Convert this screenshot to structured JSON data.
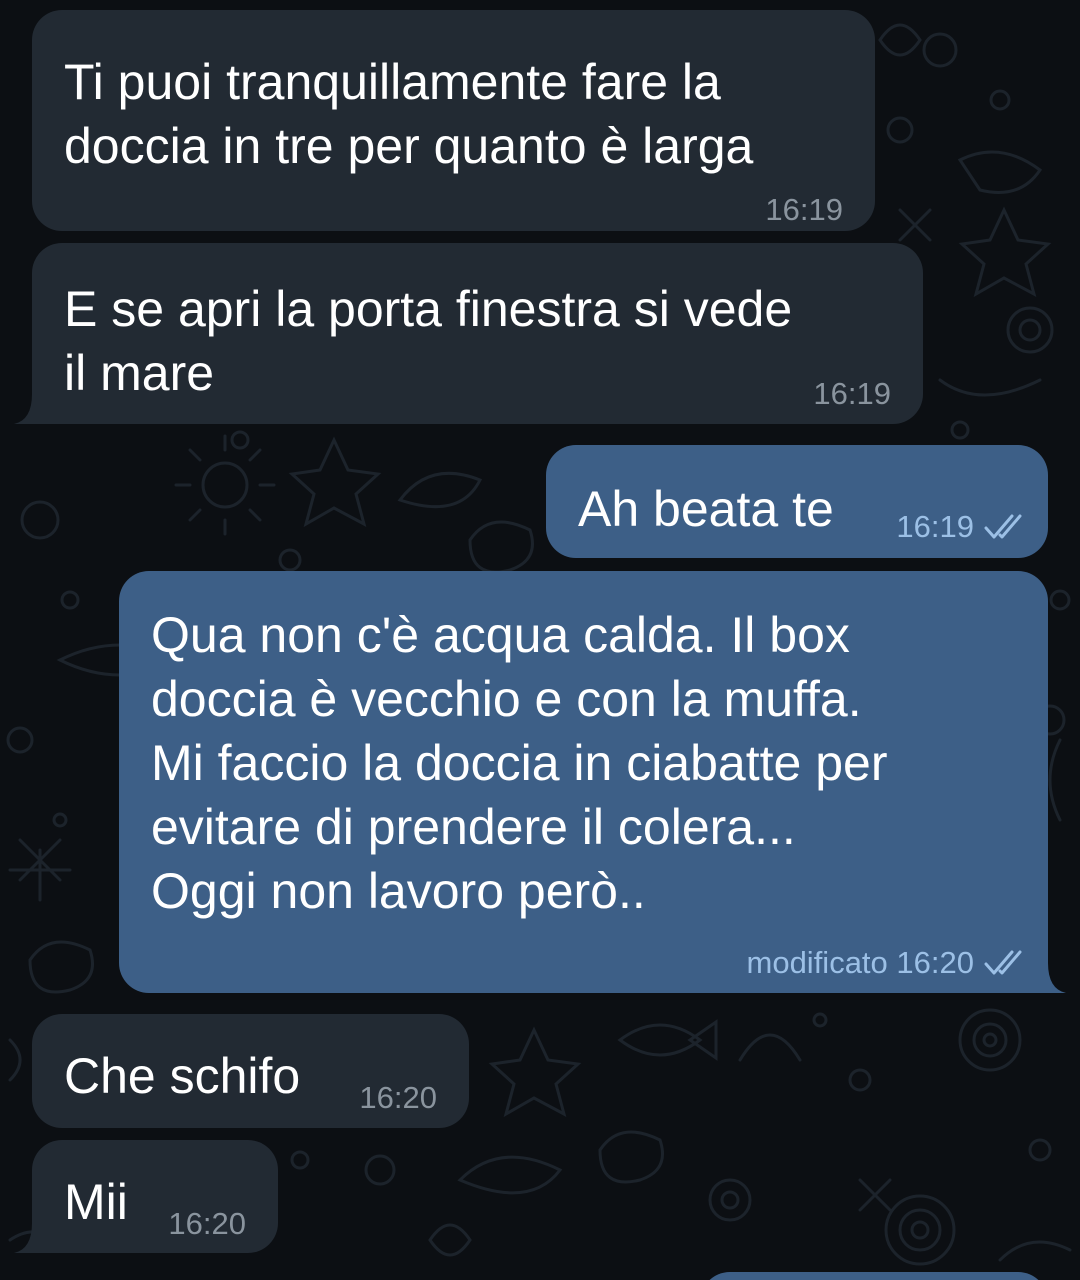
{
  "messages": [
    {
      "direction": "incoming",
      "text": "Ti puoi tranquillamente fare la\ndoccia in tre per quanto è larga",
      "time": "16:19"
    },
    {
      "direction": "incoming",
      "text": "E se apri la porta finestra si vede\nil mare",
      "time": "16:19"
    },
    {
      "direction": "outgoing",
      "text": "Ah beata te",
      "time": "16:19",
      "read": true
    },
    {
      "direction": "outgoing",
      "text": "Qua non c'è acqua calda. Il box\ndoccia è vecchio e con la muffa.\nMi faccio la doccia in ciabatte per\nevitare di prendere il colera...\nOggi non lavoro però..",
      "edited_label": "modificato",
      "time": "16:20",
      "read": true
    },
    {
      "direction": "incoming",
      "text": "Che schifo",
      "time": "16:20"
    },
    {
      "direction": "incoming",
      "text": "Mii",
      "time": "16:20"
    }
  ],
  "colors": {
    "background": "#0c0f13",
    "incoming_bubble": "#222a33",
    "outgoing_bubble": "#3d5f87",
    "incoming_time": "#8a949e",
    "outgoing_time": "#9cc0e6"
  },
  "icons": {
    "read_receipt": "double-check-icon",
    "wallpaper": "sea-doodle-pattern"
  }
}
